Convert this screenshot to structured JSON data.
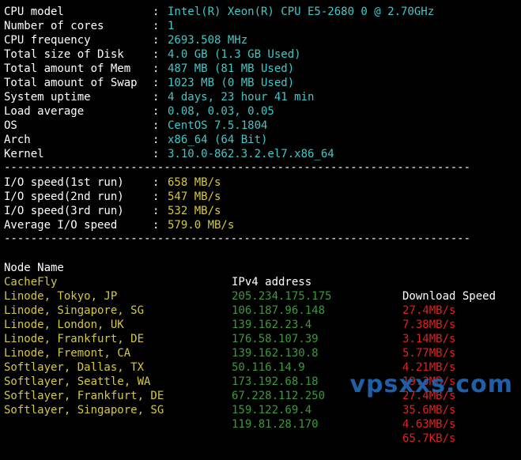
{
  "sysinfo": [
    {
      "key": "CPU model",
      "value": "Intel(R) Xeon(R) CPU E5-2680 0 @ 2.70GHz"
    },
    {
      "key": "Number of cores",
      "value": "1"
    },
    {
      "key": "CPU frequency",
      "value": "2693.508 MHz"
    },
    {
      "key": "Total size of Disk",
      "value": "4.0 GB (1.3 GB Used)"
    },
    {
      "key": "Total amount of Mem",
      "value": "487 MB (81 MB Used)"
    },
    {
      "key": "Total amount of Swap",
      "value": "1023 MB (0 MB Used)"
    },
    {
      "key": "System uptime",
      "value": "4 days, 23 hour 41 min"
    },
    {
      "key": "Load average",
      "value": "0.08, 0.03, 0.05"
    },
    {
      "key": "OS",
      "value": "CentOS 7.5.1804"
    },
    {
      "key": "Arch",
      "value": "x86_64 (64 Bit)"
    },
    {
      "key": "Kernel",
      "value": "3.10.0-862.3.2.el7.x86_64"
    }
  ],
  "separator": "----------------------------------------------------------------------",
  "io": [
    {
      "key": "I/O speed(1st run)",
      "value": "658 MB/s"
    },
    {
      "key": "I/O speed(2nd run)",
      "value": "547 MB/s"
    },
    {
      "key": "I/O speed(3rd run)",
      "value": "532 MB/s"
    },
    {
      "key": "Average I/O speed",
      "value": "579.0 MB/s"
    }
  ],
  "speedtest": {
    "headers": {
      "name": "Node Name",
      "ip": "IPv4 address",
      "speed": "Download Speed"
    },
    "rows": [
      {
        "name": "CacheFly",
        "ip": "205.234.175.175",
        "speed": "27.4MB/s"
      },
      {
        "name": "Linode, Tokyo, JP",
        "ip": "106.187.96.148",
        "speed": "7.38MB/s"
      },
      {
        "name": "Linode, Singapore, SG",
        "ip": "139.162.23.4",
        "speed": "3.14MB/s"
      },
      {
        "name": "Linode, London, UK",
        "ip": "176.58.107.39",
        "speed": "5.77MB/s"
      },
      {
        "name": "Linode, Frankfurt, DE",
        "ip": "139.162.130.8",
        "speed": "4.21MB/s"
      },
      {
        "name": "Linode, Fremont, CA",
        "ip": "50.116.14.9",
        "speed": "19.3MB/s"
      },
      {
        "name": "Softlayer, Dallas, TX",
        "ip": "173.192.68.18",
        "speed": "27.4MB/s"
      },
      {
        "name": "Softlayer, Seattle, WA",
        "ip": "67.228.112.250",
        "speed": "35.6MB/s"
      },
      {
        "name": "Softlayer, Frankfurt, DE",
        "ip": "159.122.69.4",
        "speed": "4.63MB/s"
      },
      {
        "name": "Softlayer, Singapore, SG",
        "ip": "119.81.28.170",
        "speed": "65.7KB/s"
      }
    ]
  },
  "watermark": "vpsxxs.com",
  "colors": {
    "background": "#000000",
    "cyan": "#3ec9c9",
    "yellow": "#d6c93a",
    "green": "#3a9a3a",
    "red": "#e32020",
    "watermark": "#1e5fa8"
  }
}
